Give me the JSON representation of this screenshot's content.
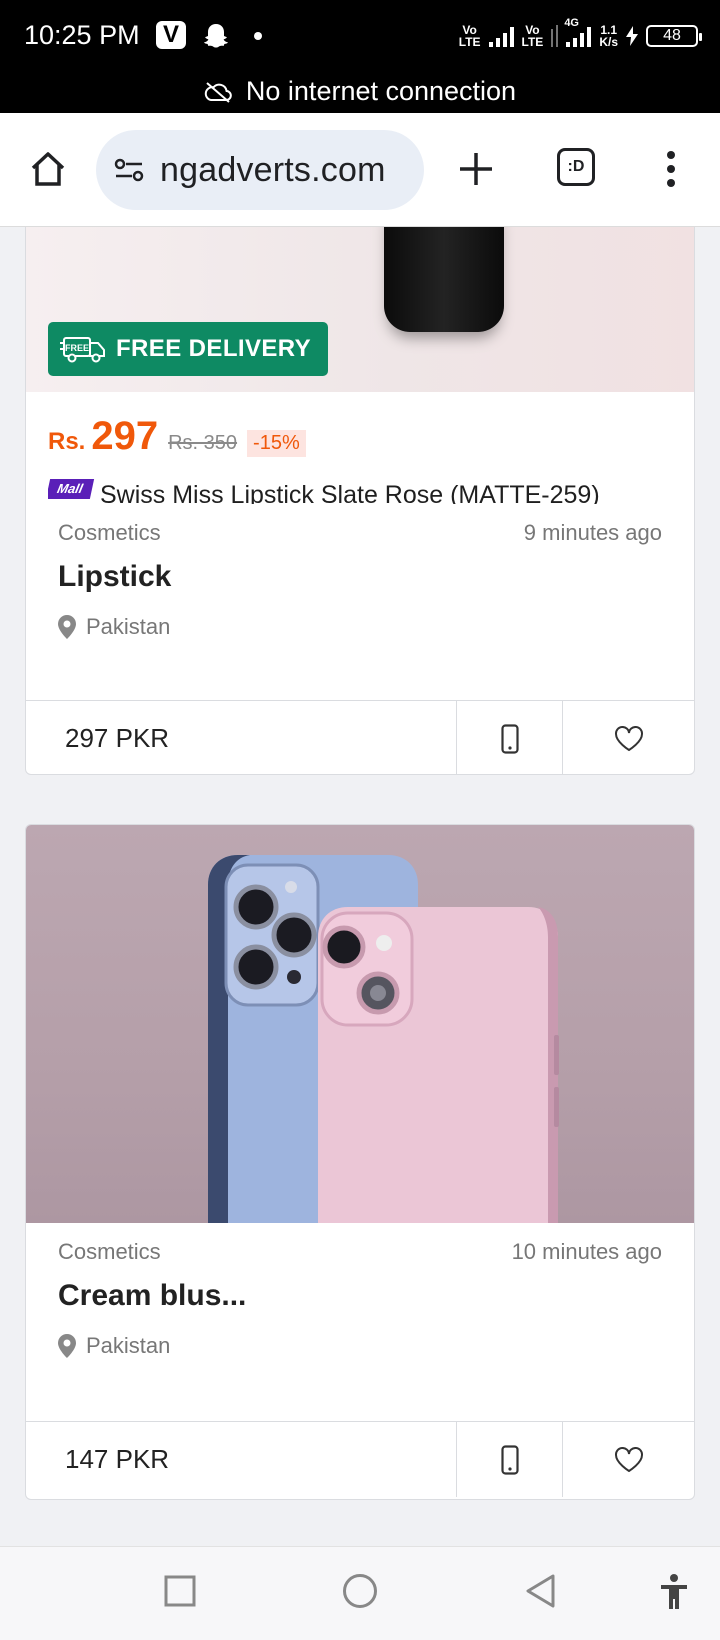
{
  "status_bar": {
    "time": "10:25 PM",
    "v_badge": "V",
    "sim1_label": "Vo\nLTE",
    "sim2_label": "Vo\nLTE",
    "network_type": "4G",
    "data_speed_value": "1.1",
    "data_speed_unit": "K/s",
    "battery_level": "48",
    "connection_banner": "No internet connection"
  },
  "browser": {
    "url": "ngadverts.com",
    "tab_switcher_label": ":D"
  },
  "listings": [
    {
      "promo": {
        "badge_small": "FREE",
        "delivery_label": "FREE DELIVERY",
        "currency_prefix": "Rs.",
        "price": "297",
        "old_price": "Rs. 350",
        "discount": "-15%",
        "mall_tag": "Mall",
        "product_title": "Swiss Miss Lipstick Slate Rose (MATTE-259)"
      },
      "category": "Cosmetics",
      "time_ago": "9 minutes ago",
      "title": "Lipstick",
      "location": "Pakistan",
      "price_label": "297 PKR"
    },
    {
      "category": "Cosmetics",
      "time_ago": "10 minutes ago",
      "title": "Cream blus...",
      "location": "Pakistan",
      "price_label": "147 PKR"
    }
  ],
  "colors": {
    "accent_orange": "#f0580a",
    "delivery_green": "#0e8a63",
    "mall_purple": "#5a1fb8"
  }
}
